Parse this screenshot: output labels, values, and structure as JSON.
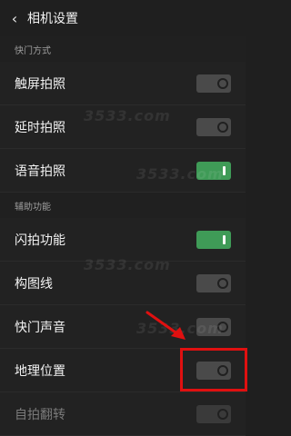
{
  "header": {
    "back_icon": "chevron-left-icon",
    "title": "相机设置"
  },
  "sections": [
    {
      "label": "快门方式"
    },
    {
      "label": "辅助功能"
    }
  ],
  "settings": [
    {
      "label": "触屏拍照",
      "state": "off"
    },
    {
      "label": "延时拍照",
      "state": "off"
    },
    {
      "label": "语音拍照",
      "state": "on"
    },
    {
      "label": "闪拍功能",
      "state": "on"
    },
    {
      "label": "构图线",
      "state": "off"
    },
    {
      "label": "快门声音",
      "state": "off"
    },
    {
      "label": "地理位置",
      "state": "off",
      "highlighted": true
    },
    {
      "label": "自拍翻转",
      "state": "off",
      "disabled": true
    }
  ],
  "watermark": {
    "text": "3533.com"
  },
  "colors": {
    "background": "#1f1f1f",
    "toggle_on": "#3f9b57",
    "toggle_off": "#4a4a4a",
    "highlight": "#e01010"
  }
}
